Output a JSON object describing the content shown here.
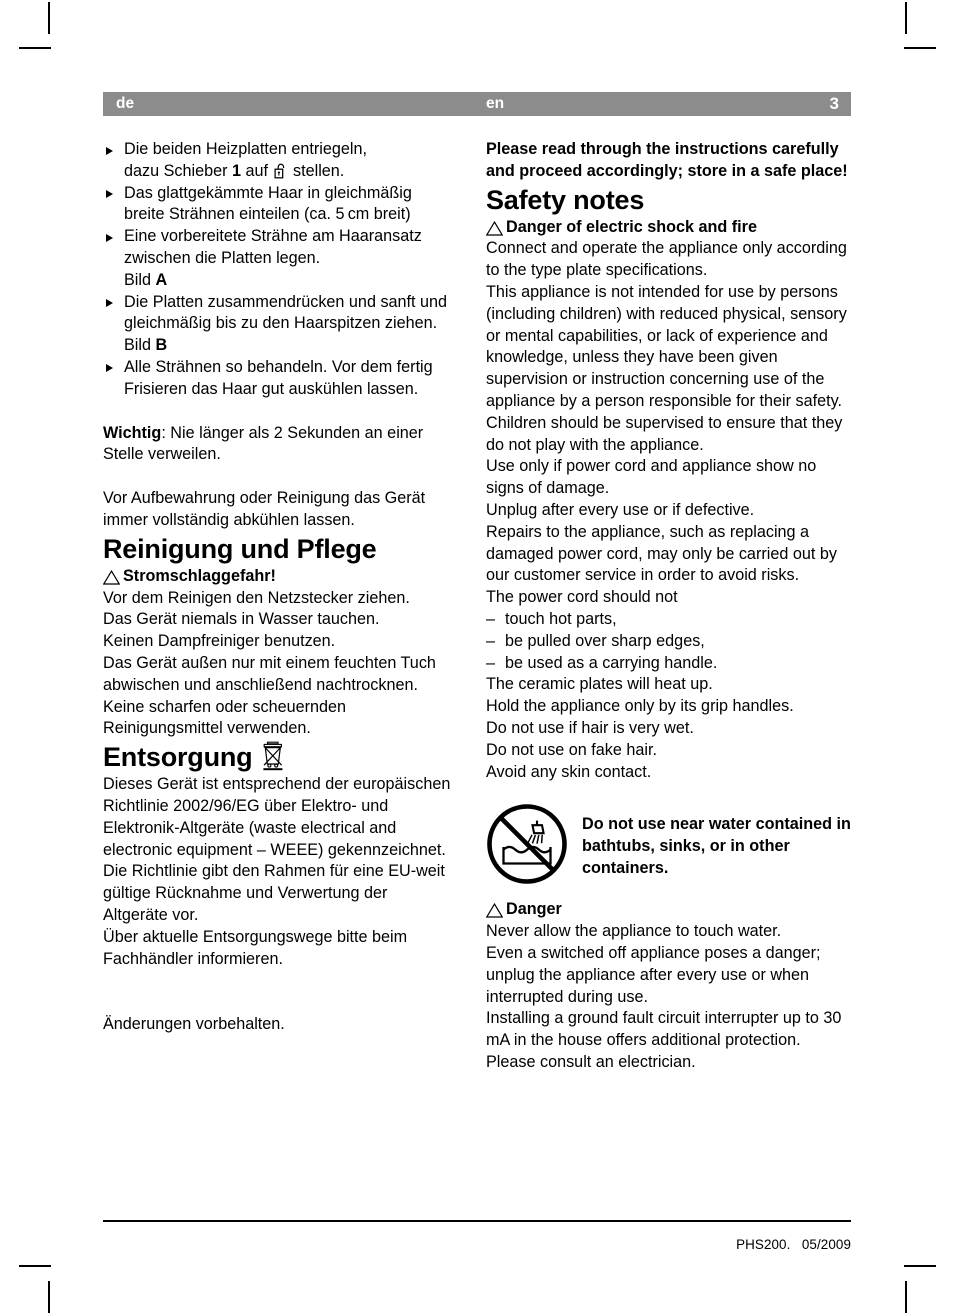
{
  "header": {
    "left_lang": "de",
    "right_lang": "en",
    "page_number": "3"
  },
  "german": {
    "bullets": [
      {
        "line1": "Die beiden Heizplatten entriegeln,",
        "line2_pre": "dazu Schieber ",
        "line2_bold": "1",
        "line2_mid": " auf ",
        "line2_icon": "open-padlock-icon",
        "line2_post": " stellen."
      },
      {
        "text": "Das glattgekämmte Haar in gleichmäßig breite Strähnen einteilen (ca. 5 cm breit)"
      },
      {
        "text": "Eine vorbereitete Strähne am Haaransatz zwischen die Platten legen.",
        "ref_pre": "Bild ",
        "ref_bold": "A"
      },
      {
        "text": "Die Platten zusammendrücken und sanft und gleichmäßig bis zu den Haarspitzen ziehen.",
        "ref_pre": "Bild ",
        "ref_bold": "B"
      },
      {
        "text": "Alle Strähnen so behandeln. Vor dem fertig Frisieren das Haar gut auskühlen lassen."
      }
    ],
    "important_bold": "Wichtig",
    "important_rest": ": Nie länger als 2 Sekunden an einer Stelle verweilen.",
    "storage_note": "Vor Aufbewahrung oder Reinigung das Gerät immer vollständig abkühlen lassen.",
    "cleaning_heading": "Reinigung und Pflege",
    "cleaning_warning": "Stromschlaggefahr!",
    "cleaning_body": "Vor dem Reinigen den Netzstecker ziehen.\nDas Gerät niemals in Wasser tauchen.\nKeinen Dampfreiniger benutzen.\nDas Gerät außen nur mit einem feuchten Tuch abwischen und anschließend nachtrocknen. Keine scharfen oder scheuernden Reinigungsmittel verwenden.",
    "disposal_heading": "Entsorgung",
    "disposal_icon": "crossed-out-wheelie-bin-icon",
    "disposal_body": "Dieses Gerät ist entsprechend der europäischen Richtlinie 2002/96/EG über Elektro- und Elektronik-Altgeräte (waste electrical and electronic equipment – WEEE) gekennzeichnet. Die Richtlinie gibt den Rahmen für eine EU-weit gültige Rücknahme und Verwertung der Altgeräte vor.",
    "disposal_body2": "Über aktuelle Entsorgungswege bitte beim Fachhändler informieren.",
    "changes_note": "Änderungen vorbehalten."
  },
  "english": {
    "intro": "Please read through the instructions carefully and proceed accordingly; store in a safe place!",
    "safety_heading": "Safety notes",
    "shock_warning": "Danger of electric shock and fire",
    "shock_body": "Connect and operate the appliance only according to the type plate specifications.\nThis appliance is not intended for use by persons (including children) with reduced physical, sensory or mental capabilities, or lack of experience and knowledge, unless they have been given supervision or instruction concerning use of the appliance by a person responsible for their safety.\nChildren should be supervised to ensure that they do not play with the appliance.\nUse only if power cord and appliance show no signs of damage.\nUnplug after every use or if defective.\nRepairs to the appliance, such as replacing a damaged power cord, may only be carried out by our customer service in order to avoid risks.\nThe power cord should not",
    "cord_items": [
      "touch hot parts,",
      "be pulled over sharp edges,",
      "be used as a carrying handle."
    ],
    "shock_body2": "The ceramic plates will heat up.\nHold the appliance only by its grip handles.\nDo not use if hair is very wet.\nDo not use on fake hair.\nAvoid any skin contact.",
    "water_icon": "no-water-bathtub-icon",
    "water_warning": "Do not use near water contained in bathtubs, sinks, or in other containers.",
    "danger_warning": "Danger",
    "danger_body": "Never allow the appliance to touch water.\nEven a switched off appliance poses a danger; unplug the appliance after every use or when interrupted during use.\nInstalling a ground fault circuit interrupter up to 30 mA in the house offers additional protection. Please consult an electrician."
  },
  "footer": {
    "model_and_date": "PHS200.   05/2009"
  }
}
